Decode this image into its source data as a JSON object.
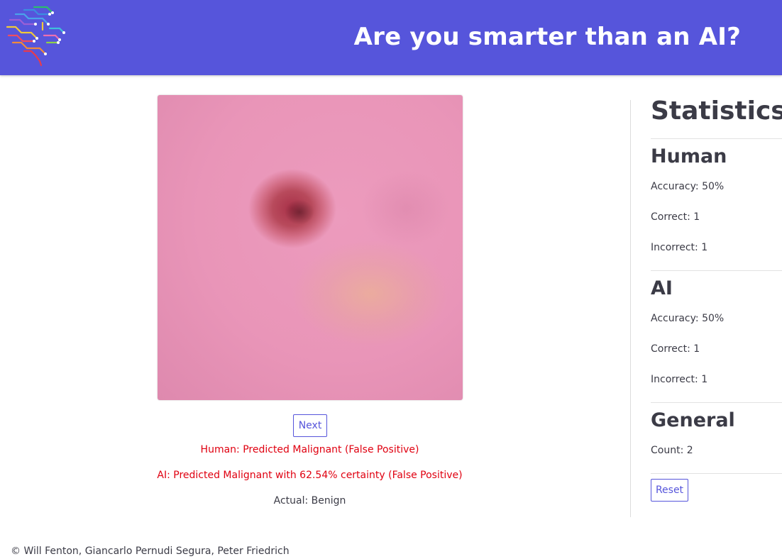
{
  "header": {
    "title": "Are you smarter than an AI?",
    "accent": "#5655db"
  },
  "main": {
    "next_label": "Next",
    "human_result": "Human: Predicted Malignant (False Positive)",
    "ai_result": "AI: Predicted Malignant with 62.54% certainty (False Positive)",
    "actual": "Actual: Benign",
    "error_color": "#e00010"
  },
  "stats": {
    "title": "Statistics",
    "human": {
      "heading": "Human",
      "accuracy": "Accuracy: 50%",
      "correct": "Correct: 1",
      "incorrect": "Incorrect: 1"
    },
    "ai": {
      "heading": "AI",
      "accuracy": "Accuracy: 50%",
      "correct": "Correct: 1",
      "incorrect": "Incorrect: 1"
    },
    "general": {
      "heading": "General",
      "count": "Count: 2"
    },
    "reset_label": "Reset"
  },
  "footer": {
    "copyright": "© Will Fenton, Giancarlo Pernudi Segura, Peter Friedrich"
  }
}
